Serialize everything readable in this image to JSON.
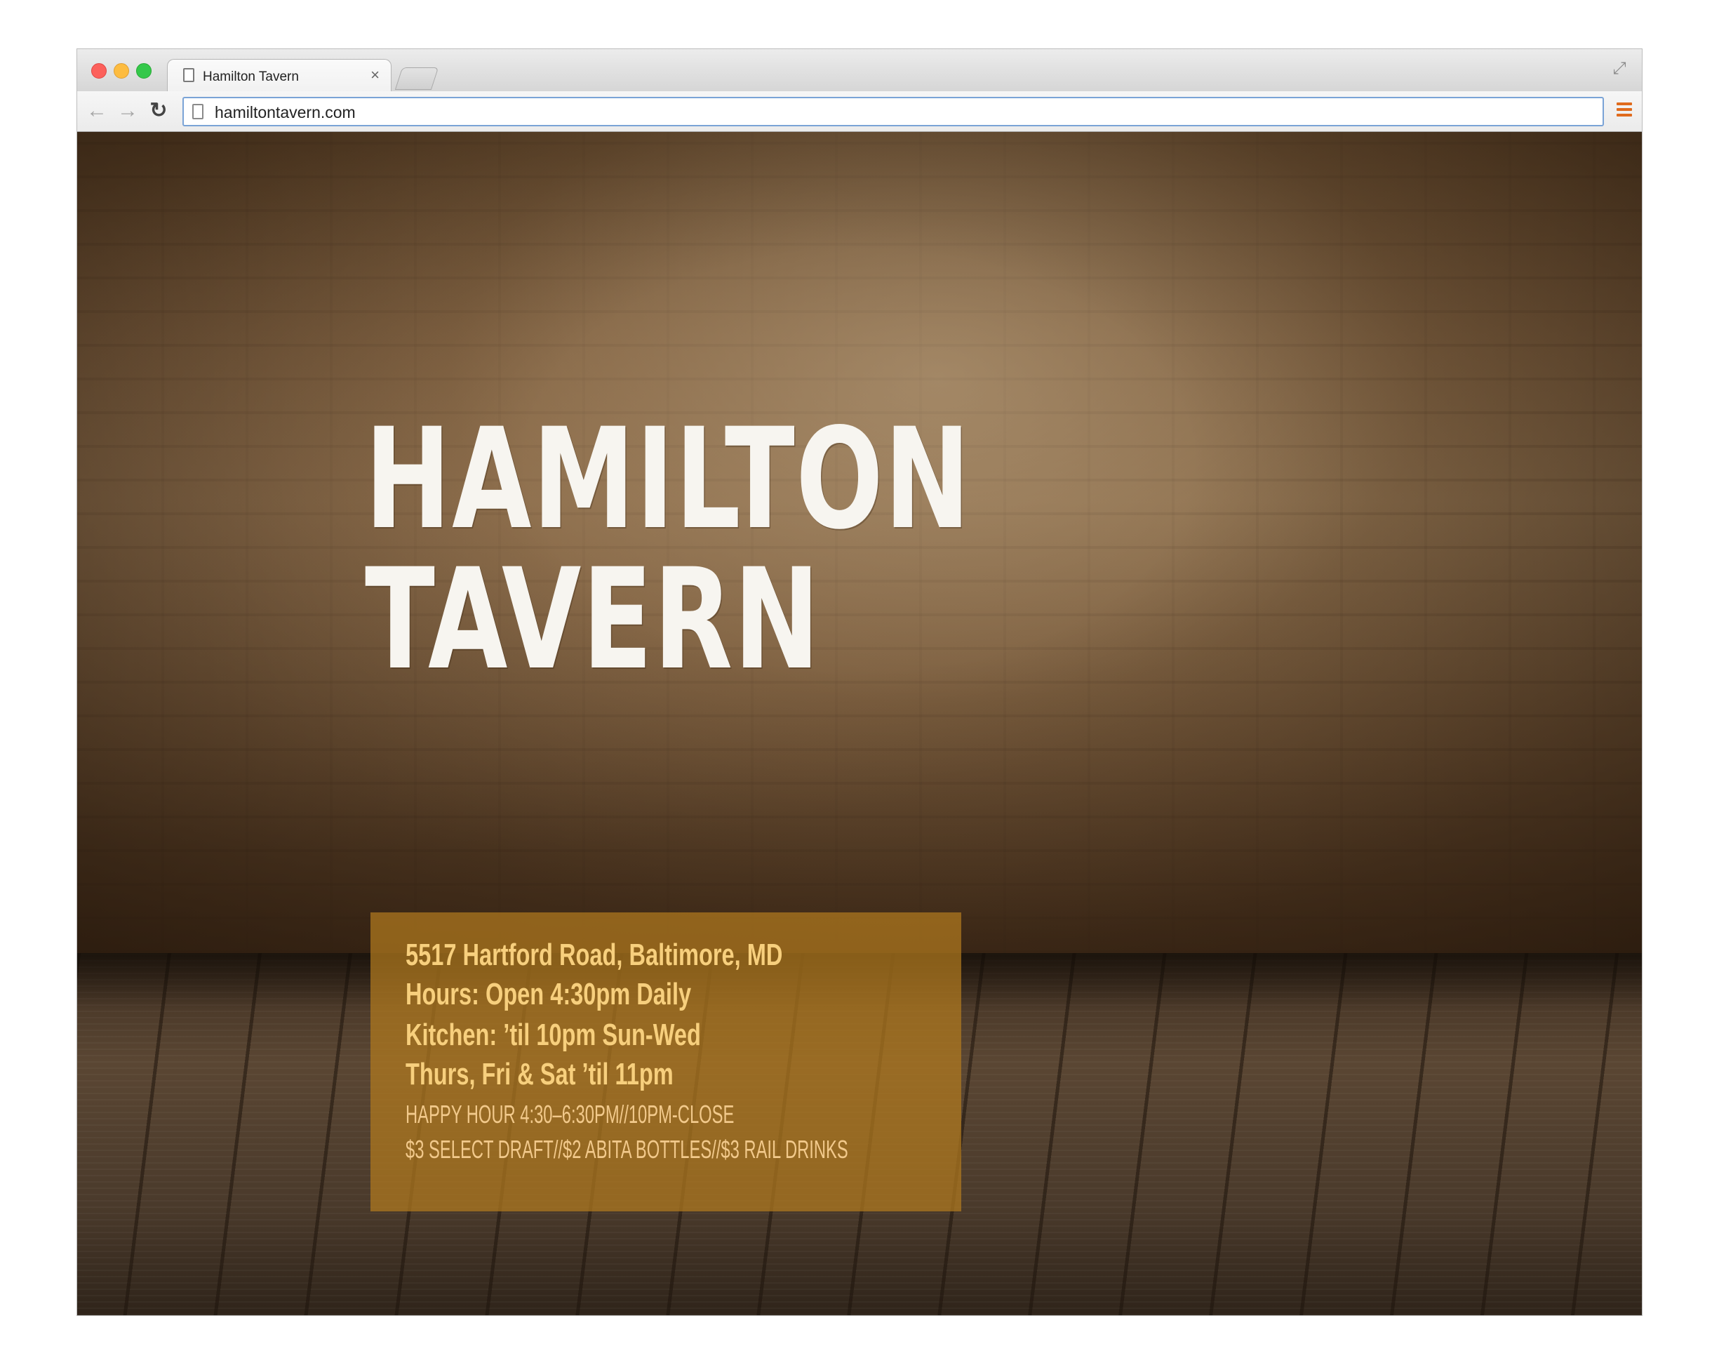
{
  "browser": {
    "tab_title": "Hamilton Tavern",
    "tab_close": "×",
    "url": "hamiltontavern.com"
  },
  "icons": {
    "back": "arrow-left-icon",
    "forward": "arrow-right-icon",
    "reload": "reload-icon",
    "menu": "hamburger-menu-icon",
    "fullscreen": "fullscreen-icon",
    "page": "page-icon"
  },
  "colors": {
    "menu_accent": "#e06b1d",
    "info_box": "#b27a1e",
    "info_text": "#f7cf7d"
  },
  "page": {
    "logo_line1": "HAMILTON",
    "logo_line2": "TAVERN",
    "info": {
      "address": "5517 Hartford Road, Baltimore, MD",
      "hours": "Hours: Open 4:30pm Daily",
      "kitchen": "Kitchen:  ’til 10pm Sun-Wed",
      "kitchen_late": "Thurs, Fri & Sat ’til 11pm",
      "happy_hour": "HAPPY HOUR 4:30–6:30PM//10PM-CLOSE",
      "specials": "$3 SELECT DRAFT//$2 ABITA BOTTLES//$3 RAIL DRINKS"
    }
  }
}
